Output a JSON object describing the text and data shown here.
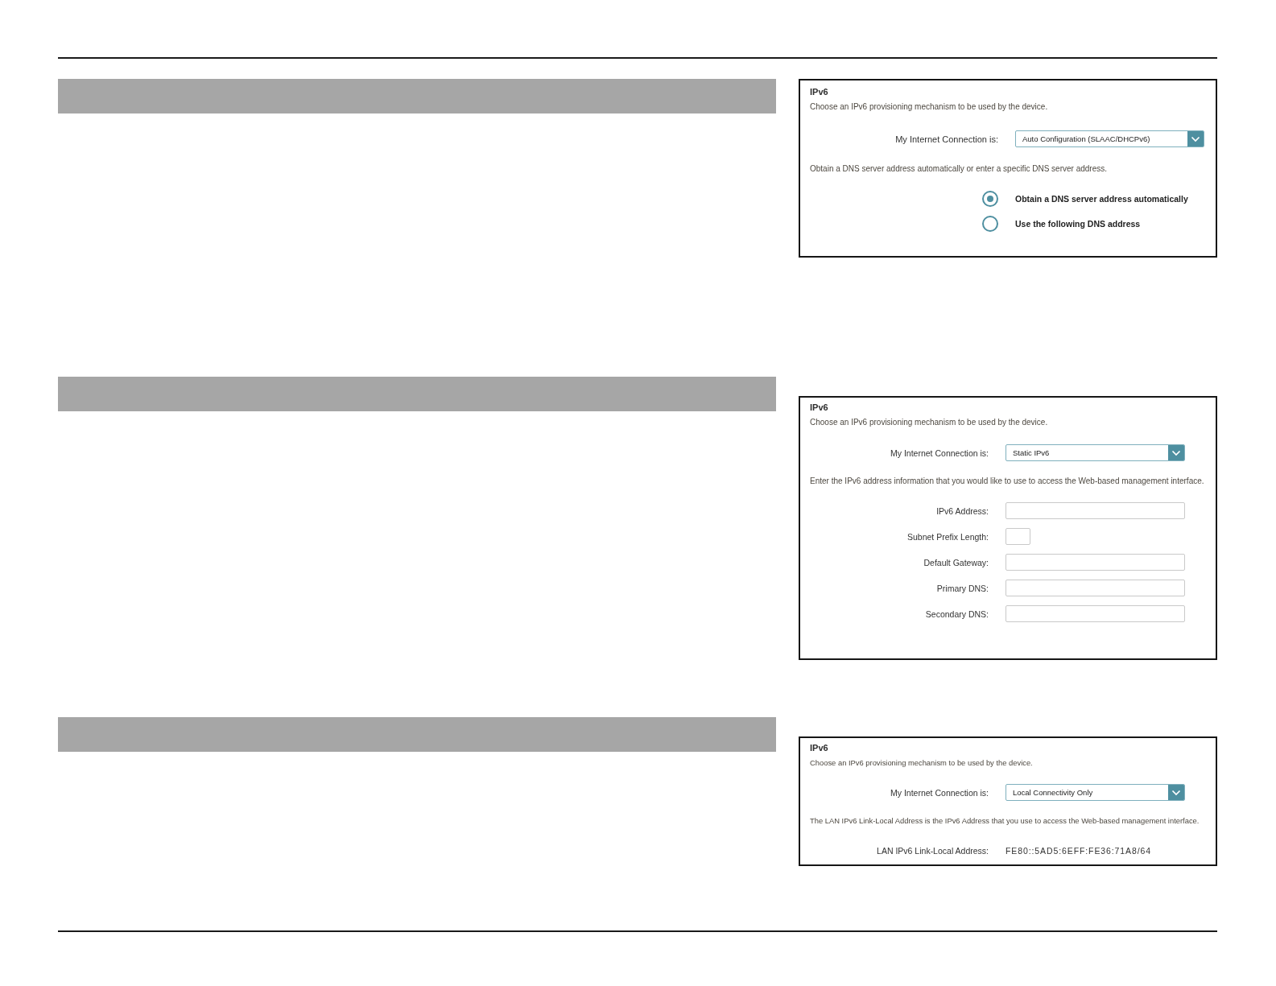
{
  "panels": [
    {
      "title": "IPv6",
      "description": "Choose an IPv6 provisioning mechanism to be used by the device.",
      "connection": {
        "label": "My Internet Connection is:",
        "value": "Auto Configuration (SLAAC/DHCPv6)"
      },
      "note": "Obtain a DNS server address automatically or enter a specific DNS server address.",
      "rows": [
        {
          "kind": "radio",
          "label": "Obtain a DNS server address automatically",
          "selected": true
        },
        {
          "kind": "radio",
          "label": "Use the following DNS address",
          "selected": false
        }
      ]
    },
    {
      "title": "IPv6",
      "description": "Choose an IPv6 provisioning mechanism to be used by the device.",
      "connection": {
        "label": "My Internet Connection is:",
        "value": "Static IPv6"
      },
      "note": "Enter the IPv6 address information that you would like to use to access the Web-based management interface.",
      "rows": [
        {
          "kind": "text",
          "label": "IPv6 Address:"
        },
        {
          "kind": "number",
          "label": "Subnet Prefix Length:"
        },
        {
          "kind": "text",
          "label": "Default Gateway:"
        },
        {
          "kind": "text",
          "label": "Primary DNS:"
        },
        {
          "kind": "text",
          "label": "Secondary DNS:"
        }
      ]
    },
    {
      "title": "IPv6",
      "description": "Choose an IPv6 provisioning mechanism to be used by the device.",
      "connection": {
        "label": "My Internet Connection is:",
        "value": "Local Connectivity Only"
      },
      "note": "The LAN IPv6 Link-Local Address is the IPv6 Address that you use to access the Web-based management interface.",
      "rows": [
        {
          "kind": "readout",
          "label": "LAN IPv6 Link-Local Address:",
          "value": "FE80::5AD5:6EFF:FE36:71A8/64"
        }
      ]
    }
  ]
}
